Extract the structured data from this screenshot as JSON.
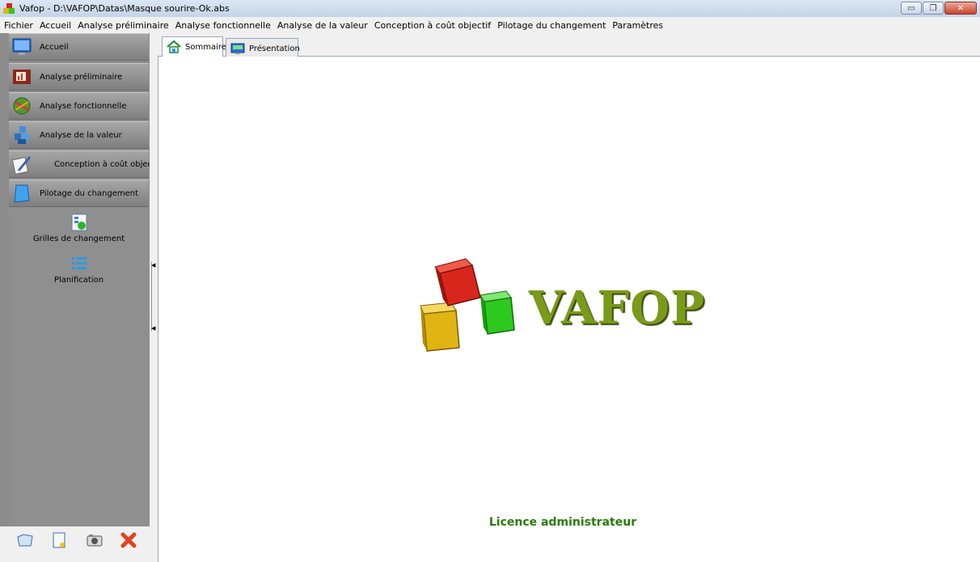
{
  "window": {
    "title": "Vafop - D:\\VAFOP\\Datas\\Masque sourire-Ok.abs",
    "minimize_label": "▭",
    "restore_label": "❐",
    "close_label": "✕"
  },
  "menu": [
    "Fichier",
    "Accueil",
    "Analyse préliminaire",
    "Analyse fonctionnelle",
    "Analyse de la valeur",
    "Conception à coût objectif",
    "Pilotage du changement",
    "Paramètres"
  ],
  "nav": [
    {
      "label": "Accueil",
      "icon": "monitor-icon"
    },
    {
      "label": "Analyse préliminaire",
      "icon": "chart-board-icon"
    },
    {
      "label": "Analyse fonctionnelle",
      "icon": "globe-arrow-icon"
    },
    {
      "label": "Analyse de la valeur",
      "icon": "value-blocks-icon"
    },
    {
      "label": "Conception à coût objectif",
      "icon": "pen-paper-icon"
    },
    {
      "label": "Pilotage du changement",
      "icon": "blue-card-icon"
    }
  ],
  "subnav": [
    {
      "label": "Grilles de changement",
      "icon": "grid-chart-icon"
    },
    {
      "label": "Planification",
      "icon": "list-icon"
    }
  ],
  "tabs": [
    {
      "label": "Sommaire",
      "icon": "home-icon",
      "active": true
    },
    {
      "label": "Présentation",
      "icon": "screen-icon",
      "active": false
    }
  ],
  "content": {
    "logo_text": "VAFOP",
    "licence": "Licence administrateur"
  },
  "colors": {
    "logo_green": "#7a9a1a",
    "licence_green": "#2b7a0b",
    "cube_red": "#d9261c",
    "cube_yellow": "#e0b412",
    "cube_green": "#2ec91f"
  }
}
